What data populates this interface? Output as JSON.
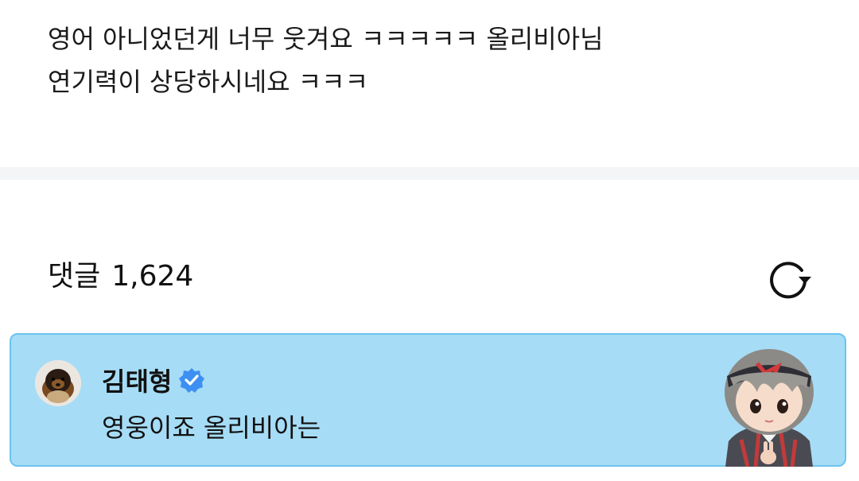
{
  "post": {
    "lines": [
      "영어 아니었던게 너무 웃겨요 ㅋㅋㅋㅋㅋ 올리비아님",
      "연기력이 상당하시네요 ㅋㅋㅋ"
    ]
  },
  "comments_section": {
    "label": "댓글",
    "count": "1,624",
    "refresh_icon": "refresh-icon"
  },
  "pinned_comment": {
    "author": "김태형",
    "verified_icon": "verified-badge-icon",
    "text": "영웅이죠 올리비아는",
    "background": "#a6dcf6",
    "border": "#6cc4ee",
    "badge_color": "#3d8ff2"
  }
}
